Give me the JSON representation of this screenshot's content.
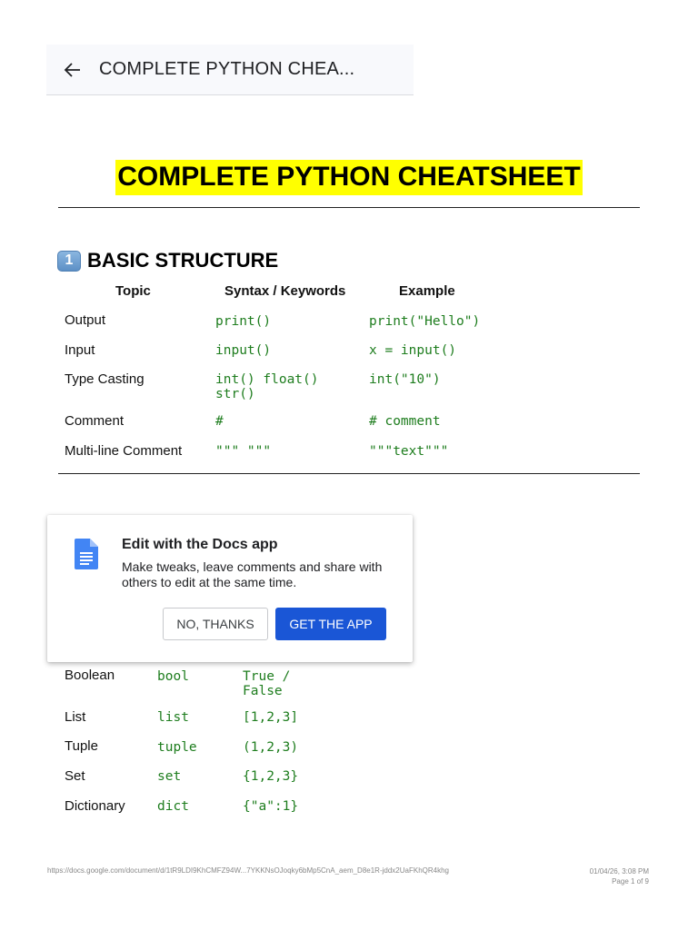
{
  "appbar": {
    "title": "COMPLETE PYTHON CHEA..."
  },
  "document": {
    "title": "COMPLETE PYTHON CHEATSHEET",
    "section1": {
      "badge": "1",
      "heading": "BASIC STRUCTURE",
      "headers": [
        "Topic",
        "Syntax / Keywords",
        "Example"
      ],
      "rows": [
        {
          "topic": "Output",
          "syntax": "print()",
          "example": "print(\"Hello\")"
        },
        {
          "topic": "Input",
          "syntax": "input()",
          "example": "x = input()"
        },
        {
          "topic": "Type Casting",
          "syntax": "int() float()\nstr()",
          "example": "int(\"10\")"
        },
        {
          "topic": "Comment",
          "syntax": "#",
          "example": "# comment"
        },
        {
          "topic": "Multi-line Comment",
          "syntax": "\"\"\" \"\"\"",
          "example": "\"\"\"text\"\"\""
        }
      ]
    },
    "section2": {
      "rows": [
        {
          "topic": "Boolean",
          "syntax": "bool",
          "example": "True /\nFalse"
        },
        {
          "topic": "List",
          "syntax": "list",
          "example": "[1,2,3]"
        },
        {
          "topic": "Tuple",
          "syntax": "tuple",
          "example": "(1,2,3)"
        },
        {
          "topic": "Set",
          "syntax": "set",
          "example": "{1,2,3}"
        },
        {
          "topic": "Dictionary",
          "syntax": "dict",
          "example": "{\"a\":1}"
        }
      ]
    }
  },
  "popup": {
    "icon": "docs-icon",
    "title": "Edit with the Docs app",
    "body": "Make tweaks, leave comments and share with others to edit at the same time.",
    "no_label": "NO, THANKS",
    "get_label": "GET THE APP"
  },
  "footer": {
    "url": "https://docs.google.com/document/d/1tR9LDI9KhCMFZ94W...7YKKNsOJoqky6bMp5CnA_aem_D8e1R-jddx2UaFKhQR4khg",
    "date": "01/04/26, 3:08 PM",
    "page": "Page 1 of 9"
  },
  "colors": {
    "highlight": "#ffff00",
    "code": "#1e7d1e",
    "primary_button": "#1a56d6"
  }
}
